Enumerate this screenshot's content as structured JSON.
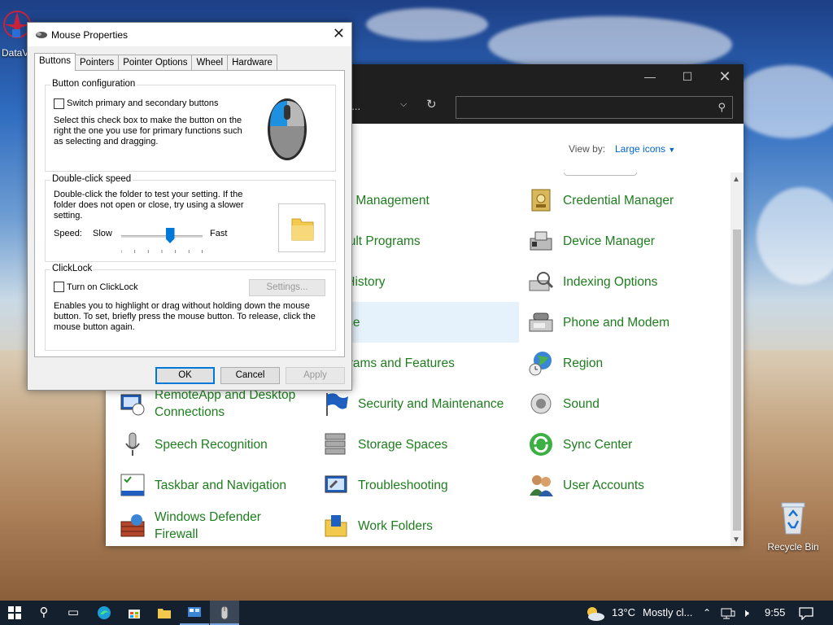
{
  "desktop": {
    "icons": [
      {
        "label": "DataV"
      },
      {
        "label": "Recycle Bin"
      }
    ]
  },
  "control_panel": {
    "address_text": "e...",
    "search_placeholder": "",
    "view_by_label": "View by:",
    "view_by_value": "Large icons",
    "items": [
      {
        "label": "Color Management",
        "icon": "color-management-icon"
      },
      {
        "label": "Credential Manager",
        "icon": "credential-manager-icon"
      },
      {
        "label": "Default Programs",
        "icon": "default-programs-icon"
      },
      {
        "label": "Device Manager",
        "icon": "device-manager-icon"
      },
      {
        "label": "File History",
        "icon": "file-history-icon"
      },
      {
        "label": "Indexing Options",
        "icon": "indexing-options-icon"
      },
      {
        "label": "Mouse",
        "icon": "mouse-icon",
        "selected": true
      },
      {
        "label": "Phone and Modem",
        "icon": "phone-modem-icon"
      },
      {
        "label": "Programs and Features",
        "icon": "programs-features-icon"
      },
      {
        "label": "Region",
        "icon": "region-icon"
      },
      {
        "label": "RemoteApp and Desktop Connections",
        "icon": "remoteapp-icon"
      },
      {
        "label": "Security and Maintenance",
        "icon": "security-flag-icon"
      },
      {
        "label": "Sound",
        "icon": "speaker-icon"
      },
      {
        "label": "Speech Recognition",
        "icon": "microphone-icon"
      },
      {
        "label": "Storage Spaces",
        "icon": "storage-spaces-icon"
      },
      {
        "label": "Sync Center",
        "icon": "sync-center-icon"
      },
      {
        "label": "Taskbar and Navigation",
        "icon": "taskbar-icon"
      },
      {
        "label": "Troubleshooting",
        "icon": "troubleshooting-icon"
      },
      {
        "label": "User Accounts",
        "icon": "user-accounts-icon"
      },
      {
        "label": "Windows Defender Firewall",
        "icon": "firewall-icon"
      },
      {
        "label": "Work Folders",
        "icon": "work-folders-icon"
      }
    ]
  },
  "mouse_dialog": {
    "title": "Mouse Properties",
    "tabs": [
      "Buttons",
      "Pointers",
      "Pointer Options",
      "Wheel",
      "Hardware"
    ],
    "active_tab": "Buttons",
    "button_config": {
      "group_title": "Button configuration",
      "checkbox_label": "Switch primary and secondary buttons",
      "checked": false,
      "description_1": "Select this check box to make the button on the",
      "description_2": "right the one you use for primary functions such",
      "description_3": "as selecting and dragging."
    },
    "double_click": {
      "group_title": "Double-click speed",
      "description_1": "Double-click the folder to test your setting. If the",
      "description_2": "folder does not open or close, try using a slower",
      "description_3": "setting.",
      "speed_label": "Speed:",
      "slow_label": "Slow",
      "fast_label": "Fast",
      "speed_value": 0.6
    },
    "clicklock": {
      "group_title": "ClickLock",
      "checkbox_label": "Turn on ClickLock",
      "checked": false,
      "settings_button": "Settings...",
      "description_1": "Enables you to highlight or drag without holding down the mouse",
      "description_2": "button. To set, briefly press the mouse button. To release, click the",
      "description_3": "mouse button again."
    },
    "buttons": {
      "ok": "OK",
      "cancel": "Cancel",
      "apply": "Apply"
    }
  },
  "taskbar": {
    "weather_temp": "13°C",
    "weather_text": "Mostly cl...",
    "time": "9:55"
  },
  "colors": {
    "link_green": "#1e7d1e",
    "accent_blue": "#0078d7",
    "taskbar_bg": "#15202e",
    "titlebar_dark": "#1f1f1f"
  }
}
